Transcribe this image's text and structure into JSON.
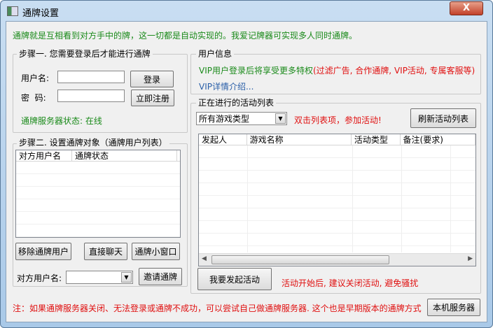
{
  "window": {
    "title": "通牌设置",
    "close": "X"
  },
  "intro": "通牌就是互相看到对方手中的牌，这一切都是自动实现的。我爱记牌器可实现多人同时通牌。",
  "step1": {
    "title": "步骤一. 您需要登录后才能进行通牌",
    "username_label": "用户名:",
    "username_value": "",
    "password_label": "密  码:",
    "password_value": "",
    "login": "登录",
    "register": "立即注册",
    "status": "通牌服务器状态: 在线"
  },
  "step2": {
    "title": "步骤二. 设置通牌对象（通牌用户列表）",
    "columns": [
      "对方用户名",
      "通牌状态"
    ],
    "remove": "移除通牌用户",
    "chat": "直接聊天",
    "mini": "通牌小窗口",
    "peer_label": "对方用户名:",
    "peer_value": "",
    "invite": "邀请通牌"
  },
  "userinfo": {
    "title": "用户信息",
    "vip_green": "VIP用户登录后将享受更多特权",
    "vip_red": "(过滤广告, 合作通牌, VIP活动, 专属客服等)",
    "vip_link": "VIP详情介绍..."
  },
  "activities": {
    "title": "正在进行的活动列表",
    "filter": "所有游戏类型",
    "hint": "双击列表项，参加活动!",
    "refresh": "刷新活动列表",
    "columns": [
      "发起人",
      "游戏名称",
      "活动类型",
      "备注(要求)"
    ],
    "start": "我要发起活动",
    "warning": "活动开始后, 建议关闭活动, 避免骚扰"
  },
  "footer": {
    "note": "注：如果通牌服务器关闭、无法登录或通牌不成功，可以尝试自己做通牌服务器. 这个也是早期版本的通牌方式",
    "server": "本机服务器"
  }
}
